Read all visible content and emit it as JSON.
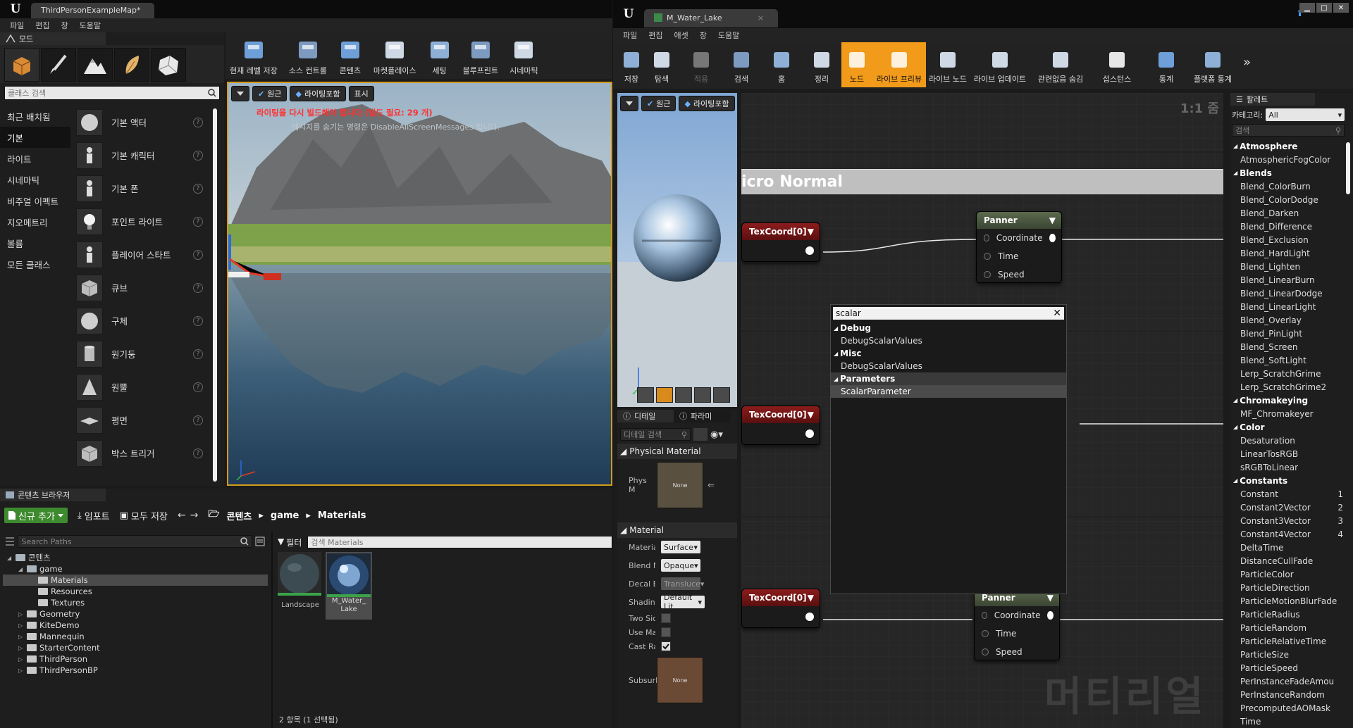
{
  "left": {
    "tab_title": "ThirdPersonExampleMap*",
    "menu": [
      "파일",
      "편집",
      "창",
      "도움말"
    ],
    "modes_tab": "모드",
    "class_search_placeholder": "클래스 검색",
    "categories": [
      "최근 배치됨",
      "기본",
      "라이트",
      "시네마틱",
      "비주얼 이펙트",
      "지오메트리",
      "볼륨",
      "모든 클래스"
    ],
    "place_items": [
      "기본 액터",
      "기본 캐릭터",
      "기본 폰",
      "포인트 라이트",
      "플레이어 스타트",
      "큐브",
      "구체",
      "원기둥",
      "원뿔",
      "평면",
      "박스 트리거"
    ],
    "toolbar": [
      "현재 레벨 저장",
      "소스 컨트롤",
      "콘텐츠",
      "마켓플레이스",
      "세팅",
      "블루프린트",
      "시네마틱"
    ],
    "viewport": {
      "btn_perspective": "원근",
      "btn_lit": "라이팅포함",
      "btn_show": "표시",
      "warning": "라이팅을 다시 빌드해야 합니다 (빌드 필요: 29 개)",
      "hint": "메시지를 숨기는 명령은 DisableAllScreenMessages 입니다."
    },
    "content_browser": {
      "tab": "콘텐츠 브라우저",
      "add_new": "신규 추가",
      "import": "임포트",
      "save_all": "모두 저장",
      "path": [
        "콘텐츠",
        "game",
        "Materials"
      ],
      "search_paths_placeholder": "Search Paths",
      "filter": "필터",
      "search_materials_placeholder": "검색 Materials",
      "tree": [
        {
          "label": "콘텐츠",
          "depth": 0,
          "expanded": true
        },
        {
          "label": "game",
          "depth": 1,
          "expanded": true
        },
        {
          "label": "Materials",
          "depth": 2,
          "selected": true
        },
        {
          "label": "Resources",
          "depth": 2
        },
        {
          "label": "Textures",
          "depth": 2
        },
        {
          "label": "Geometry",
          "depth": 1
        },
        {
          "label": "KiteDemo",
          "depth": 1
        },
        {
          "label": "Mannequin",
          "depth": 1
        },
        {
          "label": "StarterContent",
          "depth": 1
        },
        {
          "label": "ThirdPerson",
          "depth": 1
        },
        {
          "label": "ThirdPersonBP",
          "depth": 1
        }
      ],
      "assets": [
        "Landscape",
        "M_Water_\nLake"
      ],
      "status": "2 항목 (1 선택됨)"
    }
  },
  "right": {
    "tab_title": "M_Water_Lake",
    "menu": [
      "파일",
      "편집",
      "애셋",
      "창",
      "도움말"
    ],
    "toolbar": [
      "저장",
      "탐색",
      "적용",
      "검색",
      "홈",
      "정리",
      "노드",
      "라이브 프리뷰",
      "라이브 노드",
      "라이브 업데이트",
      "관련없음 숨김",
      "섭스턴스",
      "통계",
      "플랫폼 통계"
    ],
    "preview": {
      "btn_perspective": "원근",
      "btn_lit": "라이팅포함"
    },
    "details": {
      "tab_details": "디테일",
      "tab_params": "파라미",
      "search_placeholder": "디테일 검색",
      "section_physical": "Physical Material",
      "phys_label": "Phys M",
      "none1": "None",
      "section_material": "Material",
      "rows": [
        {
          "label": "Materia",
          "value": "Surface"
        },
        {
          "label": "Blend M",
          "value": "Opaque"
        },
        {
          "label": "Decal B",
          "value": "Transluce"
        },
        {
          "label": "Shadin",
          "value": "Default Lit"
        }
      ],
      "checks": [
        {
          "label": "Two Sic",
          "checked": false
        },
        {
          "label": "Use Ma",
          "checked": false
        },
        {
          "label": "Cast Ra",
          "checked": true
        }
      ],
      "subsurf_label": "Subsurl",
      "none2": "None"
    },
    "graph": {
      "zoom": "1:1 줌",
      "comment": "icro Normal",
      "watermark": "머티리얼",
      "texcoord": "TexCoord[0]",
      "panner": "Panner",
      "pins": [
        "Coordinate",
        "Time",
        "Speed"
      ]
    },
    "context_menu": {
      "search_value": "scalar",
      "groups": [
        {
          "name": "Debug",
          "items": [
            "DebugScalarValues"
          ]
        },
        {
          "name": "Misc",
          "items": [
            "DebugScalarValues"
          ]
        },
        {
          "name": "Parameters",
          "items": [
            "ScalarParameter"
          ]
        }
      ]
    },
    "palette": {
      "tab": "팔레트",
      "category_label": "카테고리:",
      "category_value": "All",
      "search_placeholder": "검색",
      "groups": [
        {
          "name": "Atmosphere",
          "items": [
            {
              "n": "AtmosphericFogColor"
            }
          ]
        },
        {
          "name": "Blends",
          "items": [
            {
              "n": "Blend_ColorBurn"
            },
            {
              "n": "Blend_ColorDodge"
            },
            {
              "n": "Blend_Darken"
            },
            {
              "n": "Blend_Difference"
            },
            {
              "n": "Blend_Exclusion"
            },
            {
              "n": "Blend_HardLight"
            },
            {
              "n": "Blend_Lighten"
            },
            {
              "n": "Blend_LinearBurn"
            },
            {
              "n": "Blend_LinearDodge"
            },
            {
              "n": "Blend_LinearLight"
            },
            {
              "n": "Blend_Overlay"
            },
            {
              "n": "Blend_PinLight"
            },
            {
              "n": "Blend_Screen"
            },
            {
              "n": "Blend_SoftLight"
            },
            {
              "n": "Lerp_ScratchGrime"
            },
            {
              "n": "Lerp_ScratchGrime2"
            }
          ]
        },
        {
          "name": "Chromakeying",
          "items": [
            {
              "n": "MF_Chromakeyer"
            }
          ]
        },
        {
          "name": "Color",
          "items": [
            {
              "n": "Desaturation"
            },
            {
              "n": "LinearTosRGB"
            },
            {
              "n": "sRGBToLinear"
            }
          ]
        },
        {
          "name": "Constants",
          "items": [
            {
              "n": "Constant",
              "k": "1"
            },
            {
              "n": "Constant2Vector",
              "k": "2"
            },
            {
              "n": "Constant3Vector",
              "k": "3"
            },
            {
              "n": "Constant4Vector",
              "k": "4"
            },
            {
              "n": "DeltaTime"
            },
            {
              "n": "DistanceCullFade"
            },
            {
              "n": "ParticleColor"
            },
            {
              "n": "ParticleDirection"
            },
            {
              "n": "ParticleMotionBlurFade"
            },
            {
              "n": "ParticleRadius"
            },
            {
              "n": "ParticleRandom"
            },
            {
              "n": "ParticleRelativeTime"
            },
            {
              "n": "ParticleSize"
            },
            {
              "n": "ParticleSpeed"
            },
            {
              "n": "PerInstanceFadeAmou"
            },
            {
              "n": "PerInstanceRandom"
            },
            {
              "n": "PrecomputedAOMask"
            },
            {
              "n": "Time"
            }
          ]
        }
      ]
    }
  }
}
